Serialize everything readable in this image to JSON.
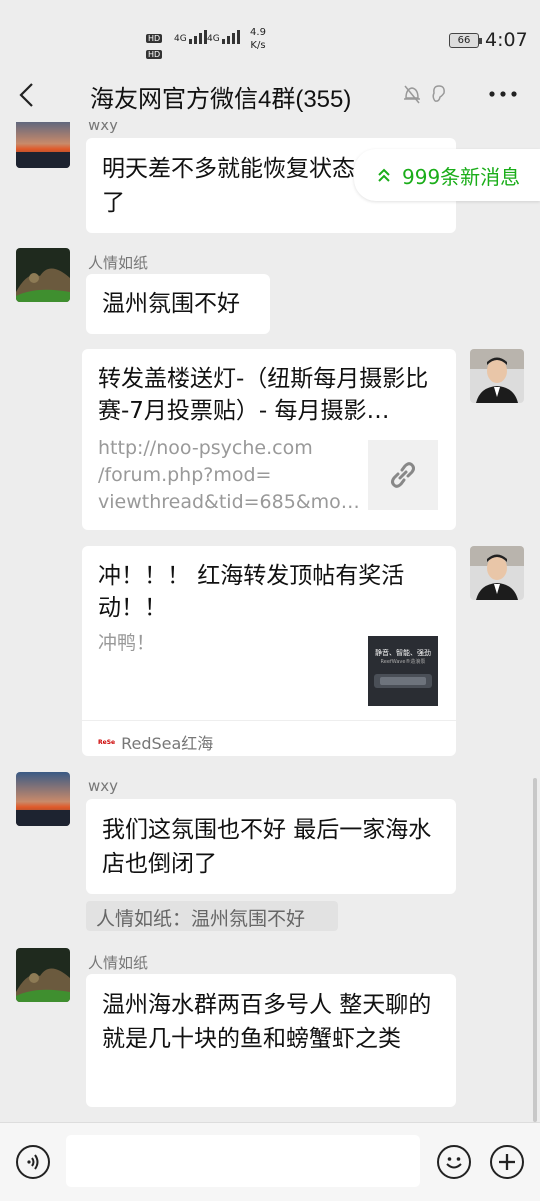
{
  "status_bar": {
    "network_left_top": "HD",
    "network_left_bottom": "HD",
    "net1": "4G",
    "net2": "4G",
    "speed_value": "4.9",
    "speed_unit": "K/s",
    "battery": "66",
    "time": "4:07"
  },
  "header": {
    "back_icon": "chevron-left-icon",
    "title": "海友网官方微信4群(355)",
    "more_label": "···"
  },
  "new_messages": {
    "label": "999条新消息",
    "icon": "double-chevron-up-icon"
  },
  "messages": [
    {
      "sender": "wxy",
      "text": "明天差不多就能恢复状态\n了"
    },
    {
      "sender": "人情如纸",
      "text": "温州氛围不好"
    },
    {
      "link_title": "转发盖楼送灯-（纽斯每月摄影比赛-7月投票贴）- 每月摄影…",
      "link_desc": "http://noo-psyche.com\n/forum.php?mod=\nviewthread&tid=685&mo…"
    },
    {
      "link_title": "冲！！！ 红海转发顶帖有奖活动！！",
      "link_desc": "冲鸭！",
      "thumb_text_1": "静音、智能、强劲",
      "thumb_text_2": "ReefWave®造浪泵",
      "source_logo": "ReSe",
      "source": "RedSea红海"
    },
    {
      "sender": "wxy",
      "text": "我们这氛围也不好 最后一家海水店也倒闭了"
    },
    {
      "quote": "人情如纸：温州氛围不好"
    },
    {
      "sender": "人情如纸",
      "text": "温州海水群两百多号人  整天聊的就是几十块的鱼和螃蟹虾之类"
    }
  ],
  "input_bar": {
    "voice_icon": "voice-icon",
    "emoji_icon": "emoji-icon",
    "plus_icon": "plus-icon",
    "value": ""
  },
  "colors": {
    "background": "#ededed",
    "accent_green": "#1aad19",
    "bubble": "#ffffff"
  }
}
